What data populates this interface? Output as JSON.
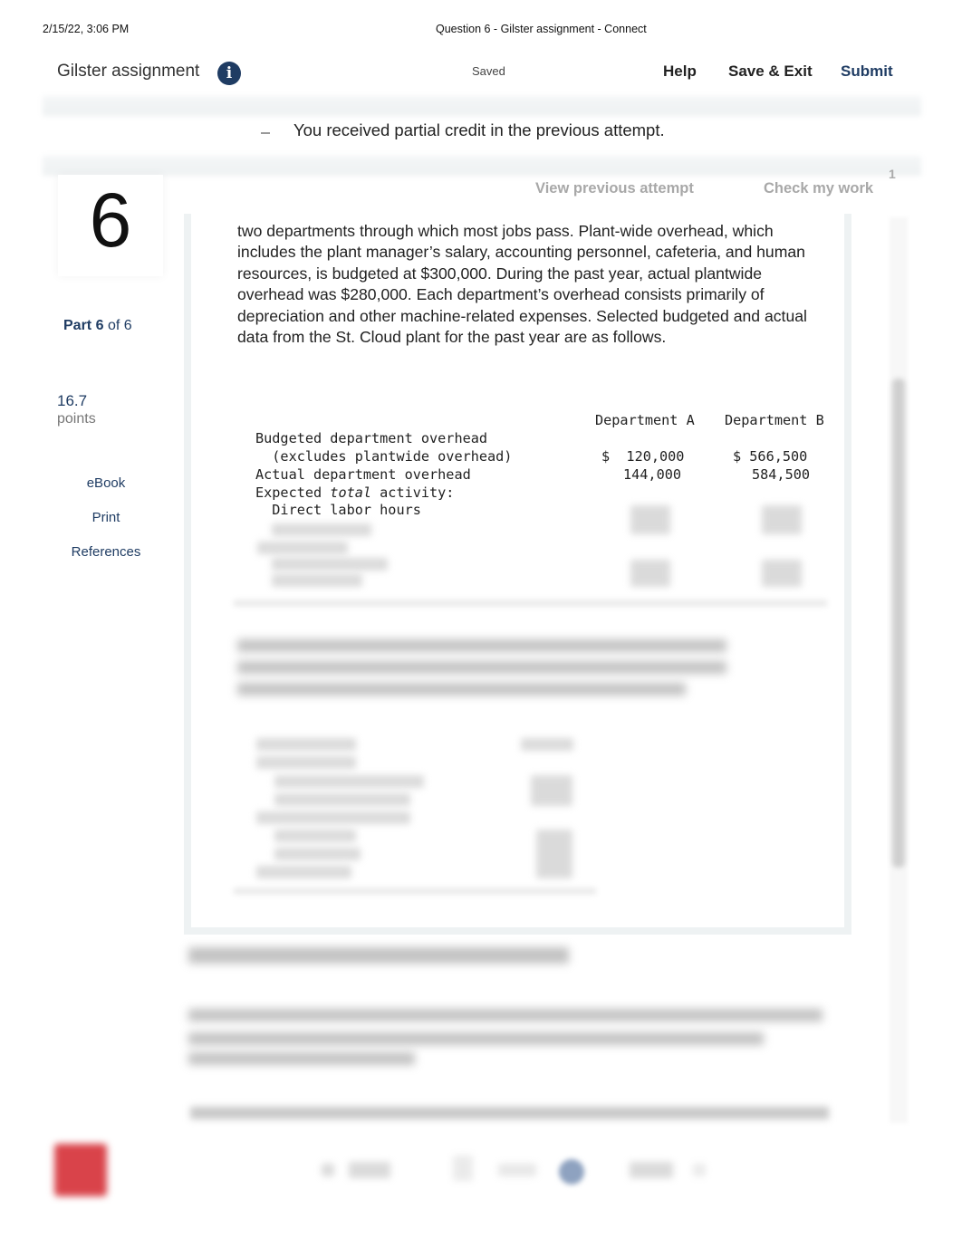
{
  "print_header": {
    "datetime": "2/15/22, 3:06 PM",
    "page_title": "Question 6 - Gilster assignment - Connect"
  },
  "topbar": {
    "assignment_title": "Gilster assignment",
    "info_icon": "i",
    "status": "Saved",
    "help_label": "Help",
    "save_exit_label": "Save & Exit",
    "submit_label": "Submit",
    "accent_color": "#1f3c63"
  },
  "notice": {
    "text": "You received partial credit in the previous attempt."
  },
  "question": {
    "number": "6",
    "part_prefix": "Part",
    "part_current": "6",
    "part_suffix": "of 6",
    "points_value": "16.7",
    "points_label": "points"
  },
  "tools": {
    "ebook": "eBook",
    "print": "Print",
    "references": "References"
  },
  "actions": {
    "view_previous": "View previous attempt",
    "check_my_work": "Check my work",
    "check_count": "1"
  },
  "content": {
    "paragraph": "two departments through which most jobs pass. Plant-wide overhead, which includes the plant manager’s salary, accounting personnel, cafeteria, and human resources, is budgeted at $300,000. During the past year, actual plantwide overhead was $280,000. Each department’s overhead consists primarily of depreciation and other machine-related expenses. Selected budgeted and actual data from the St. Cloud plant for the past year are as follows.",
    "table": {
      "headers": [
        "",
        "Department A",
        "Department B"
      ],
      "rows": [
        {
          "label": "Budgeted department overhead",
          "a": "",
          "b": ""
        },
        {
          "label": "  (excludes plantwide overhead)",
          "a": "$  120,000",
          "b": "$ 566,500"
        },
        {
          "label": "Actual department overhead",
          "a": "144,000",
          "b": "584,500"
        },
        {
          "label_pre": "Expected ",
          "label_em": "total",
          "label_post": " activity:",
          "a": "",
          "b": ""
        },
        {
          "label": "  Direct labor hours",
          "a": "",
          "b": ""
        }
      ]
    }
  }
}
